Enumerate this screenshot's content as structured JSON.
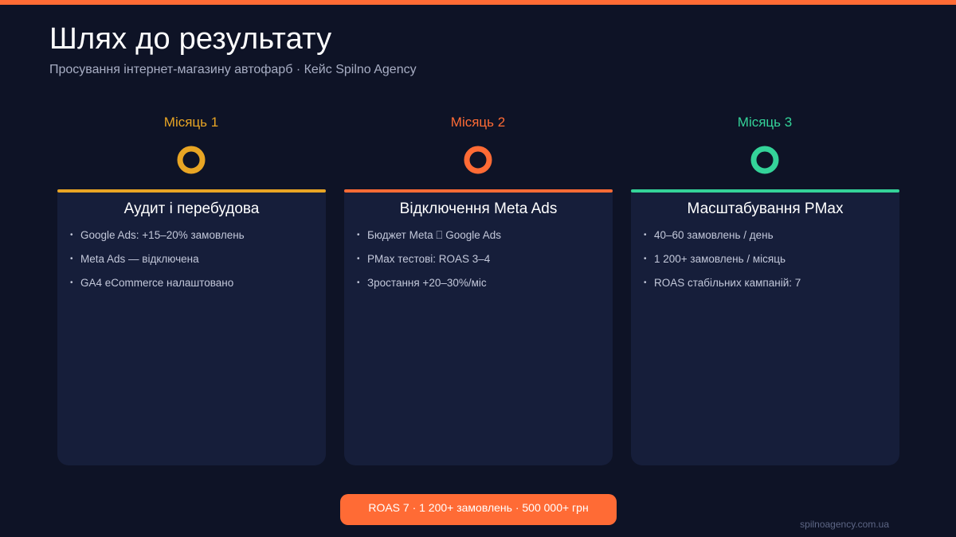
{
  "title": "Шлях до результату",
  "subtitle": "Просування інтернет-магазину автофарб · Кейс Spilno Agency",
  "colors": {
    "background": "#0e1326",
    "accent": "#ff6b35",
    "month1": "#e8a524",
    "month2": "#ff6b35",
    "month3": "#34d399",
    "card": "#161e3a"
  },
  "stages": [
    {
      "month": "Місяць 1",
      "title": "Аудит і перебудова",
      "items": [
        "Google Ads: +15–20% замовлень",
        "Meta Ads — відключена",
        "GA4 eCommerce налаштовано"
      ]
    },
    {
      "month": "Місяць 2",
      "title": "Відключення Meta Ads",
      "items": [
        "Бюджет Meta ⎕ Google Ads",
        "PMax тестові: ROAS 3–4",
        "Зростання +20–30%/міс"
      ]
    },
    {
      "month": "Місяць 3",
      "title": "Масштабування PMax",
      "items": [
        "40–60 замовлень / день",
        "1 200+ замовлень / місяць",
        "ROAS стабільних кампаній: 7"
      ]
    }
  ],
  "summary": "ROAS 7  ·  1 200+ замовлень  ·  500 000+ грн",
  "footer": "spilnoagency.com.ua"
}
